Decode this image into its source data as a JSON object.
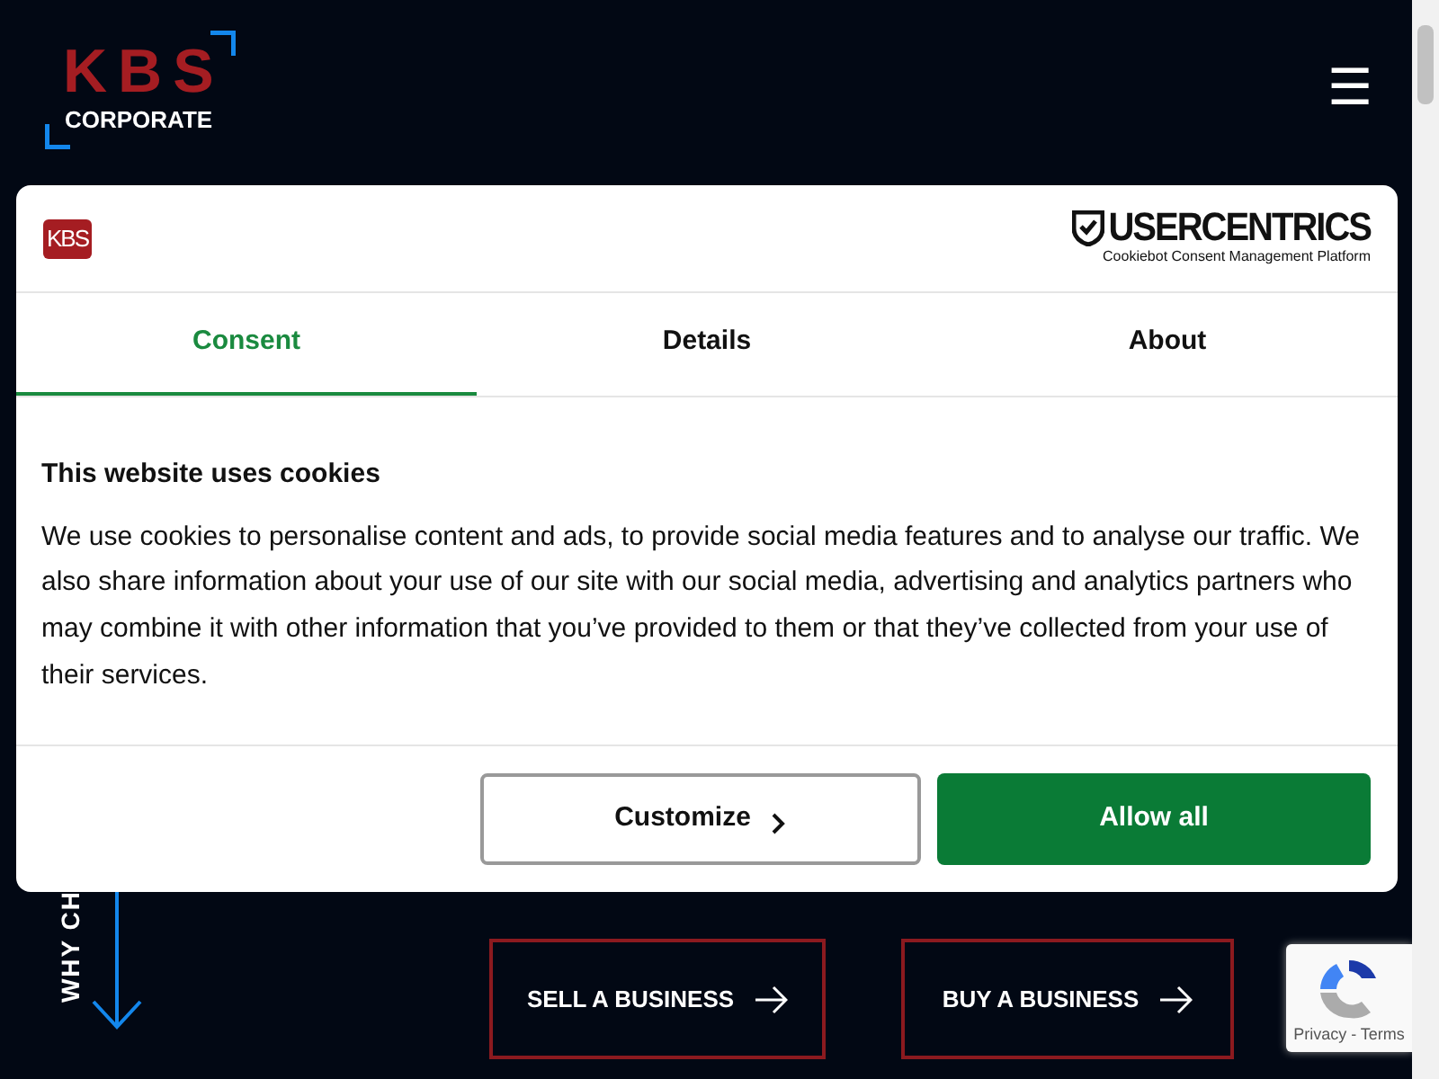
{
  "header": {
    "logo": {
      "brand": "KBS",
      "subtitle": "CORPORATE"
    },
    "menu_icon": "☰"
  },
  "cookie_dialog": {
    "logo": "KBS",
    "provider": {
      "name": "USERCENTRICS",
      "tagline": "Cookiebot Consent Management Platform"
    },
    "tabs": [
      {
        "label": "Consent",
        "selected": true
      },
      {
        "label": "Details",
        "selected": false
      },
      {
        "label": "About",
        "selected": false
      }
    ],
    "heading": "This website uses cookies",
    "text": "We use cookies to personalise content and ads, to provide social media features and to analyse our traffic. We also share information about your use of our site with our social media, advertising and analytics partners who may combine it with other information that you’ve provided to them or that they’ve collected from your use of their services.",
    "buttons": [
      {
        "label": "Customize",
        "kind": "secondary"
      },
      {
        "label": "Allow all",
        "kind": "primary"
      }
    ]
  },
  "section": {
    "vertical_label": "WHY CH",
    "actions": [
      {
        "label": "SELL A BUSINESS"
      },
      {
        "label": "BUY A BUSINESS"
      }
    ]
  },
  "recaptcha": {
    "links": "Privacy - Terms"
  }
}
